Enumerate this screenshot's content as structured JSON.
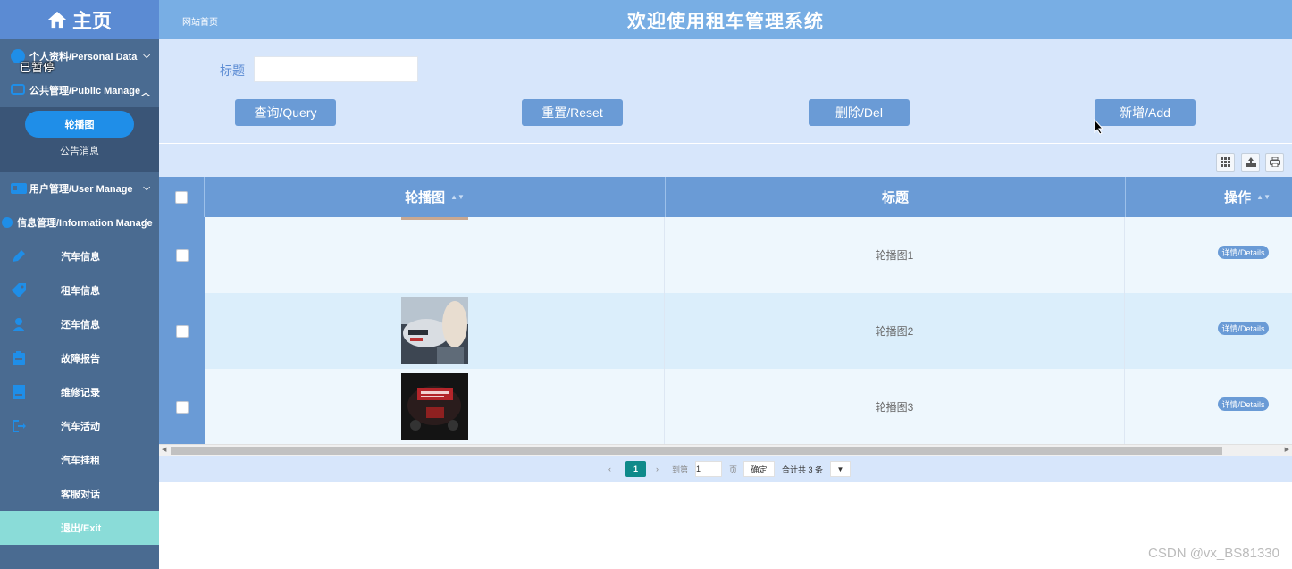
{
  "sidebar": {
    "home_label": "主页",
    "paused_label": "已暂停",
    "groups": [
      {
        "label": "个人资料/Personal Data"
      },
      {
        "label": "公共管理/Public Manage"
      },
      {
        "label": "用户管理/User Manage"
      },
      {
        "label": "信息管理/Information Manage"
      }
    ],
    "public_sub": [
      "轮播图",
      "公告消息"
    ],
    "info_items": [
      "汽车信息",
      "租车信息",
      "还车信息",
      "故障报告",
      "维修记录",
      "汽车活动",
      "汽车挂租",
      "客服对话"
    ],
    "exit_label": "退出/Exit"
  },
  "header": {
    "breadcrumb": "网站首页",
    "title": "欢迎使用租车管理系统"
  },
  "search": {
    "label": "标题",
    "value": "",
    "buttons": {
      "query": "查询/Query",
      "reset": "重置/Reset",
      "delete": "删除/Del",
      "add": "新增/Add"
    }
  },
  "table": {
    "columns": [
      "轮播图",
      "标题",
      "操作"
    ],
    "rows": [
      {
        "title": "轮播图1",
        "action": "详情/Details"
      },
      {
        "title": "轮播图2",
        "action": "详情/Details"
      },
      {
        "title": "轮播图3",
        "action": "详情/Details"
      }
    ]
  },
  "pager": {
    "current": "1",
    "goto_label": "到第",
    "goto_value": "1",
    "page_unit": "页",
    "confirm": "确定",
    "total": "合计共 3 条"
  },
  "watermark": "CSDN @vx_BS81330",
  "colors": {
    "header": "#78aee4",
    "sidebar": "#4a6b91",
    "accent": "#6a9bd6",
    "search_bg": "#d7e6fb"
  }
}
